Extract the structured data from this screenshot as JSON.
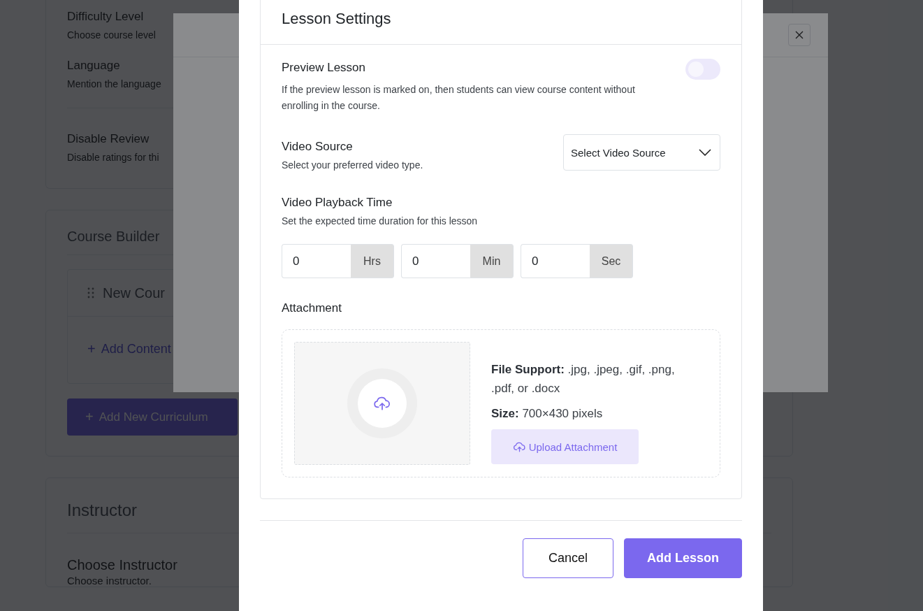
{
  "background_page": {
    "settings": [
      {
        "label": "Difficulty Level",
        "description": "Choose course level"
      },
      {
        "label": "Language",
        "description": "Mention the language"
      },
      {
        "label": "Disable Review",
        "description": "Disable ratings for thi"
      }
    ],
    "course_builder": {
      "title": "Course Builder",
      "topic": "New Cour",
      "add_content_icon": "+",
      "add_content": "Add Content",
      "add_curriculum_icon": "+",
      "add_curriculum": "Add New Curriculum"
    },
    "instructor": {
      "title": "Instructor",
      "label": "Choose Instructor",
      "description": "Choose instructor."
    }
  },
  "lesson_modal": {
    "title": "Lesson Settings",
    "preview": {
      "label": "Preview Lesson",
      "description": "If the preview lesson is marked on, then students can view course content without enrolling in the course.",
      "on": false
    },
    "video_source": {
      "label": "Video Source",
      "description": "Select your preferred video type.",
      "placeholder": "Select Video Source"
    },
    "playback": {
      "label": "Video Playback Time",
      "description": "Set the expected time duration for this lesson",
      "fields": [
        {
          "value": "0",
          "unit": "Hrs"
        },
        {
          "value": "0",
          "unit": "Min"
        },
        {
          "value": "0",
          "unit": "Sec"
        }
      ]
    },
    "attachment": {
      "label": "Attachment",
      "file_support": "**File Support:** .jpg, .jpeg, .gif, .png, .pdf, or .docx",
      "size": "**Size:** 700×430 pixels",
      "upload_button": "Upload Attachment"
    },
    "buttons": [
      {
        "label": "Cancel",
        "kind": "secondary"
      },
      {
        "label": "Add Lesson",
        "kind": "primary"
      }
    ]
  }
}
